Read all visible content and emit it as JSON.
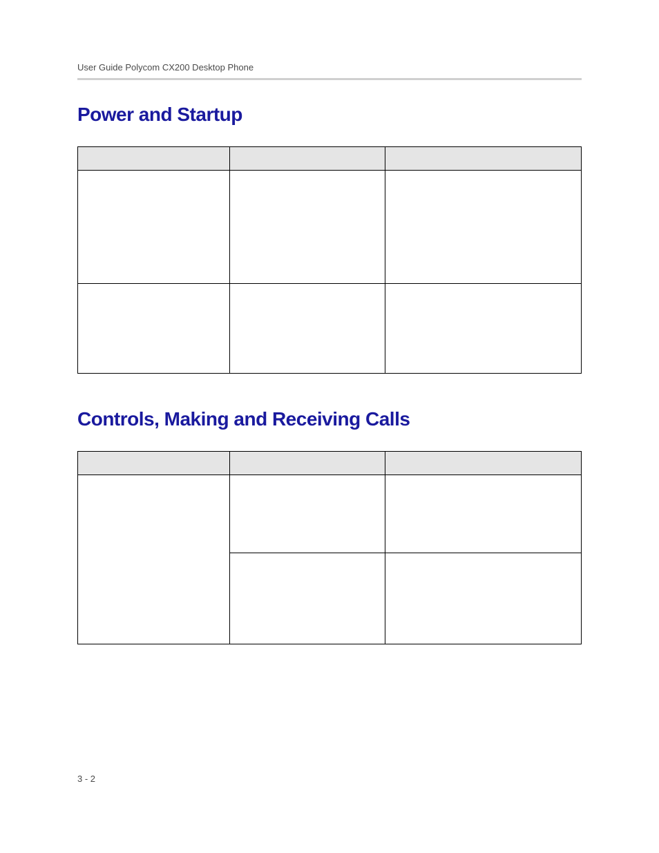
{
  "header": {
    "title": "User Guide Polycom CX200 Desktop Phone"
  },
  "sections": {
    "section1_heading": "Power and Startup",
    "section2_heading": "Controls, Making and Receiving Calls"
  },
  "footer": {
    "page_number": "3 - 2"
  }
}
